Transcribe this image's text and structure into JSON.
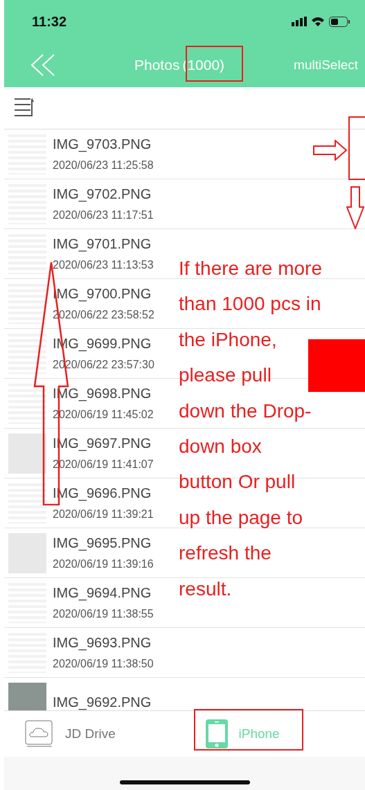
{
  "status_bar": {
    "time": "11:32"
  },
  "nav": {
    "title": "Photos",
    "count": "(1000)",
    "action": "multiSelect"
  },
  "rows": [
    {
      "name": "IMG_9703.PNG",
      "date": "2020/06/23 11:25:58"
    },
    {
      "name": "IMG_9702.PNG",
      "date": "2020/06/23 11:17:51"
    },
    {
      "name": "IMG_9701.PNG",
      "date": "2020/06/23 11:13:53"
    },
    {
      "name": "IMG_9700.PNG",
      "date": "2020/06/22 23:58:52"
    },
    {
      "name": "IMG_9699.PNG",
      "date": "2020/06/22 23:57:30"
    },
    {
      "name": "IMG_9698.PNG",
      "date": "2020/06/19 11:45:02"
    },
    {
      "name": "IMG_9697.PNG",
      "date": "2020/06/19 11:41:07"
    },
    {
      "name": "IMG_9696.PNG",
      "date": "2020/06/19 11:39:21"
    },
    {
      "name": "IMG_9695.PNG",
      "date": "2020/06/19 11:39:16"
    },
    {
      "name": "IMG_9694.PNG",
      "date": "2020/06/19 11:38:55"
    },
    {
      "name": "IMG_9693.PNG",
      "date": "2020/06/19 11:38:50"
    },
    {
      "name": "IMG_9692.PNG"
    }
  ],
  "tabs": [
    {
      "label": "JD Drive",
      "selected": false,
      "kind": "cloud"
    },
    {
      "label": "iPhone",
      "selected": true,
      "kind": "phone"
    }
  ],
  "annotation": {
    "lines": [
      "If there are more",
      "than 1000 pcs in",
      "the iPhone,",
      "please pull",
      "down the Drop-",
      "down box",
      "button Or pull",
      "up the page to",
      "refresh the",
      "result."
    ]
  }
}
